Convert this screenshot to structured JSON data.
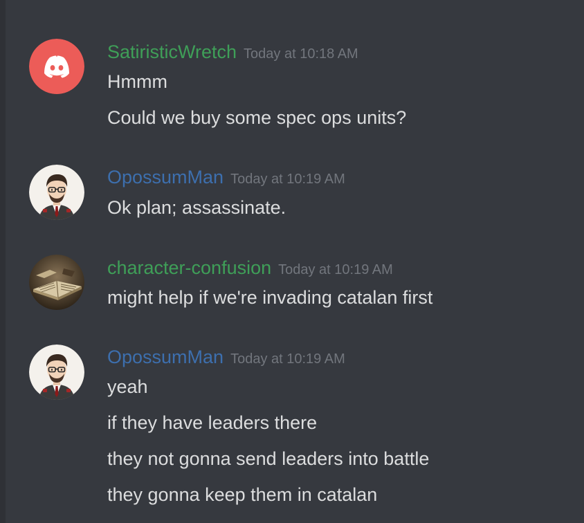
{
  "colors": {
    "background": "#36393f",
    "username_green": "#43b581",
    "username_blue": "#3f76b3",
    "timestamp": "#72767d",
    "text": "#dcddde"
  },
  "messages": [
    {
      "author": "SatiristicWretch",
      "author_color": "#3f9f58",
      "avatar_icon": "discord-logo-icon",
      "timestamp": "Today at 10:18 AM",
      "lines": [
        "Hmmm",
        "Could we buy some spec ops units?"
      ]
    },
    {
      "author": "OpossumMan",
      "author_color": "#3d6fae",
      "avatar_icon": "cartoon-man-icon",
      "timestamp": "Today at 10:19 AM",
      "lines": [
        "Ok plan; assassinate."
      ]
    },
    {
      "author": "character-confusion",
      "author_color": "#3f9f58",
      "avatar_icon": "old-book-icon",
      "timestamp": "Today at 10:19 AM",
      "lines": [
        "might help if we're invading catalan first"
      ]
    },
    {
      "author": "OpossumMan",
      "author_color": "#3d6fae",
      "avatar_icon": "cartoon-man-icon",
      "timestamp": "Today at 10:19 AM",
      "lines": [
        "yeah",
        "if they have leaders there",
        "they not gonna send leaders into battle",
        "they gonna keep them in catalan"
      ]
    }
  ]
}
